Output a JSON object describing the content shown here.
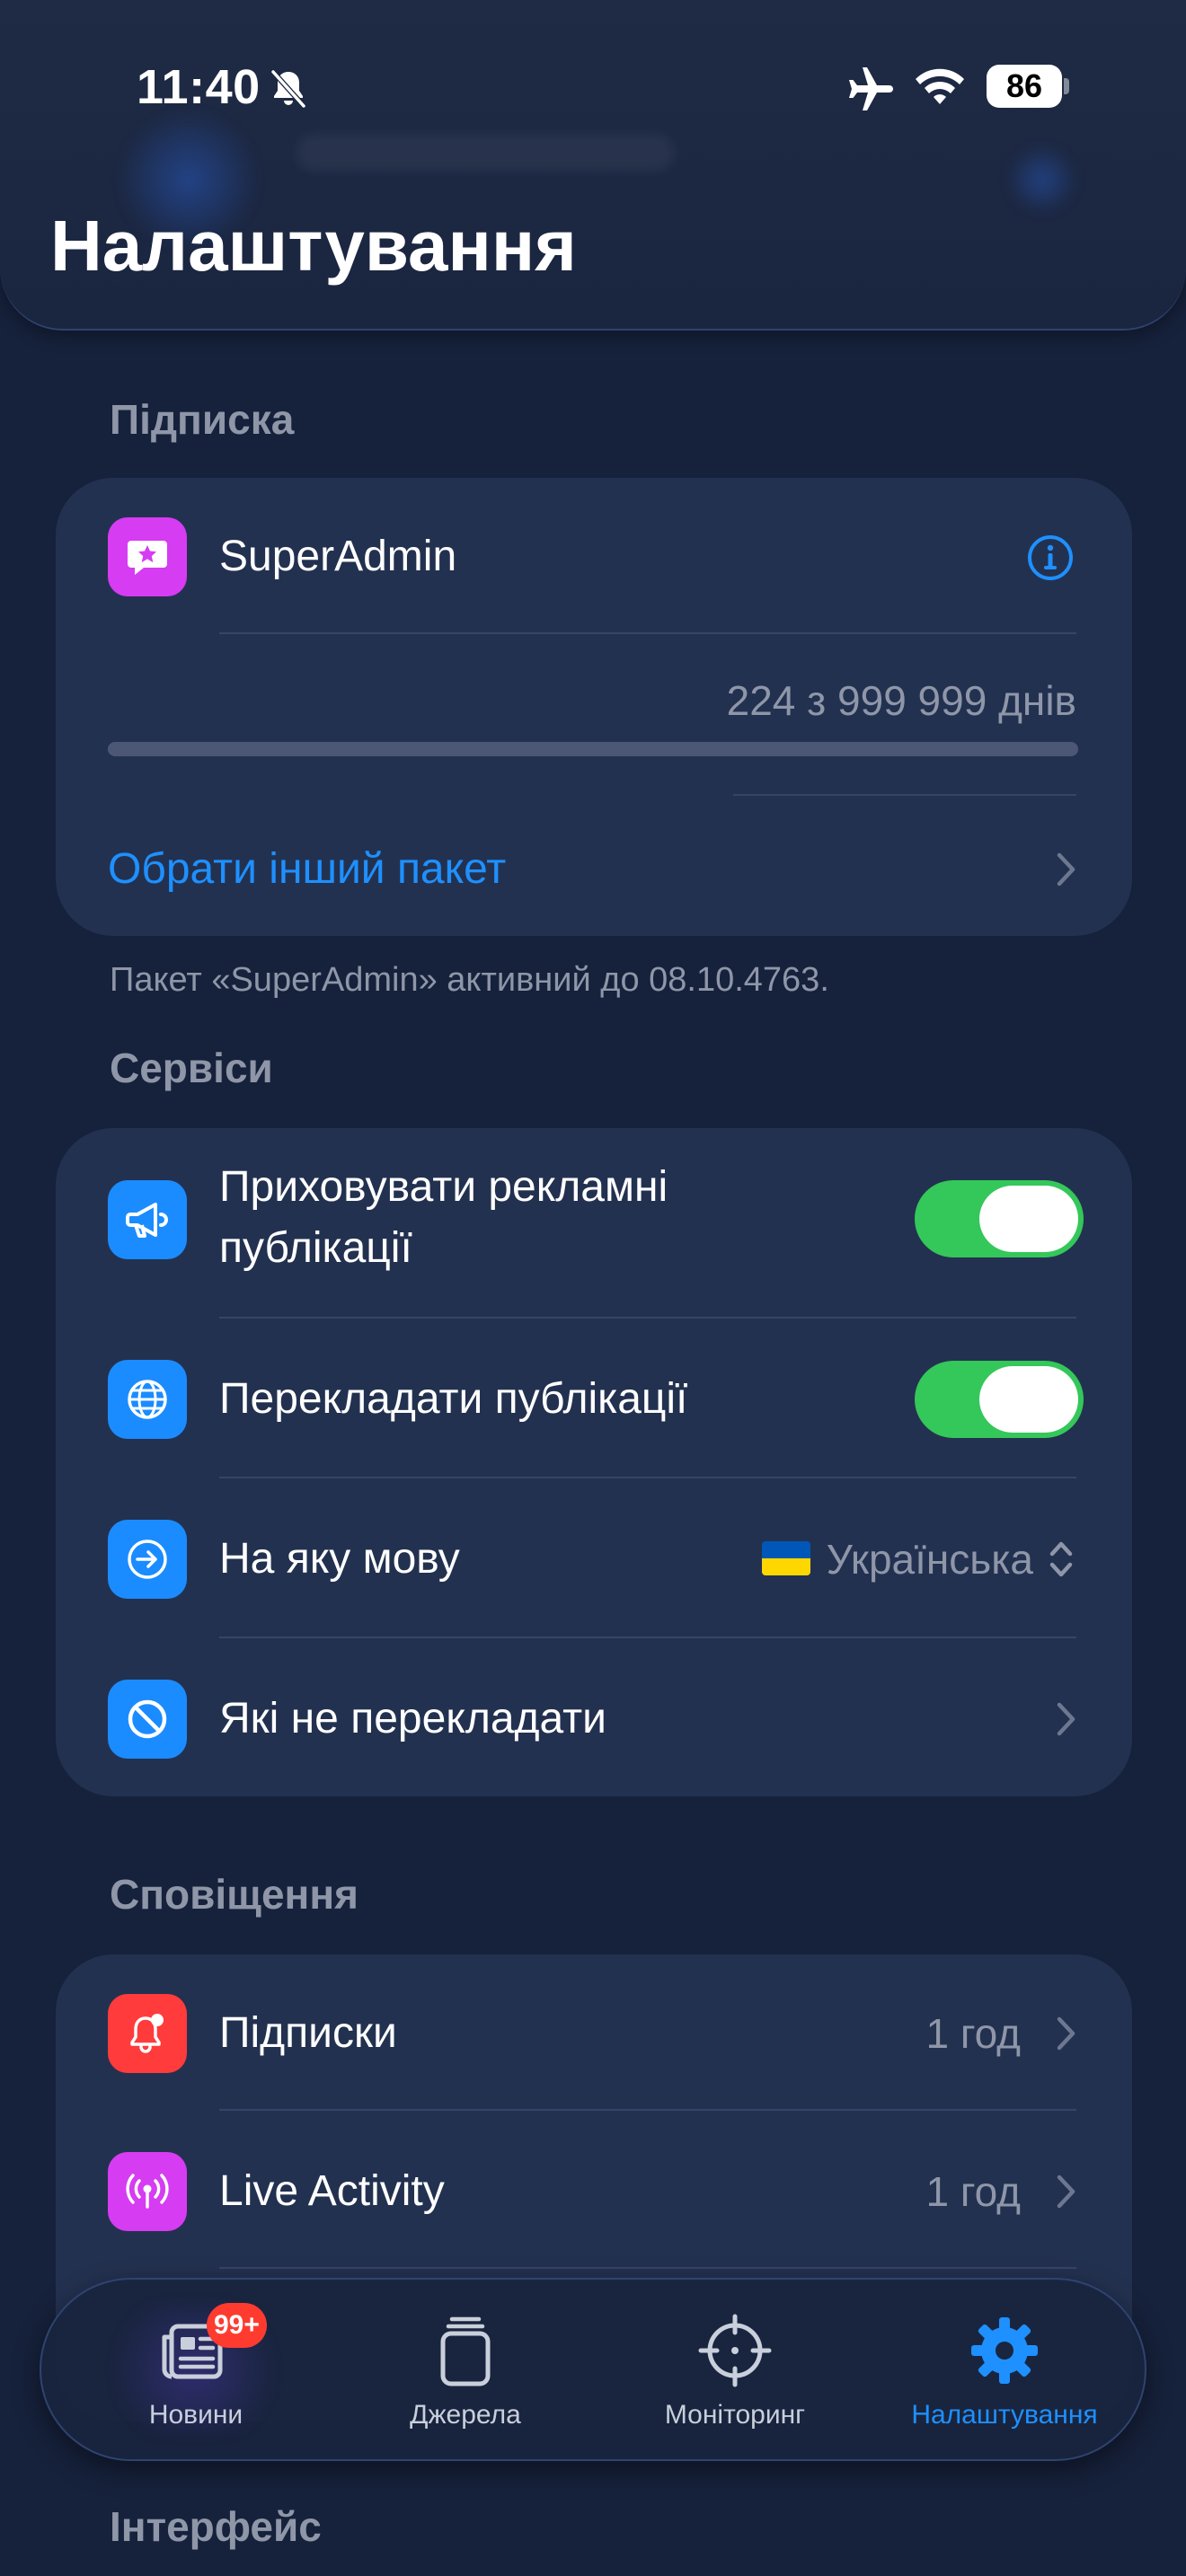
{
  "status_bar": {
    "time": "11:40",
    "battery": "86"
  },
  "header": {
    "title": "Налаштування"
  },
  "subscription": {
    "section_title": "Підписка",
    "plan_name": "SuperAdmin",
    "days_text": "224 з 999 999 днів",
    "days_used": 224,
    "days_total": 999999,
    "change_plan": "Обрати інший пакет",
    "footnote": "Пакет «SuperAdmin» активний до 08.10.4763."
  },
  "services": {
    "section_title": "Сервіси",
    "hide_ads_label": "Приховувати рекламні публікації",
    "hide_ads_line1": "Приховувати рекламні",
    "hide_ads_line2": "публікації",
    "hide_ads_on": true,
    "translate_label": "Перекладати публікації",
    "translate_on": true,
    "language_label": "На яку мову",
    "language_flag": "🇺🇦",
    "language_value": "Українська",
    "exclude_label": "Які не перекладати"
  },
  "notifications": {
    "section_title": "Сповіщення",
    "items": [
      {
        "label": "Підписки",
        "value": "1 год"
      },
      {
        "label": "Live Activity",
        "value": "1 год"
      }
    ]
  },
  "interface": {
    "section_title": "Інтерфейс"
  },
  "tabbar": {
    "tabs": [
      {
        "label": "Новини",
        "badge": "99+"
      },
      {
        "label": "Джерела"
      },
      {
        "label": "Моніторинг"
      },
      {
        "label": "Налаштування"
      }
    ],
    "active_index": 3
  },
  "colors": {
    "background": "#16213b",
    "card": "#233150",
    "accent": "#1e90ff",
    "toggle_on": "#34c759",
    "icon_purple": "#d63cf2",
    "icon_blue": "#1a8cff",
    "icon_red": "#ff3b3b",
    "badge_red": "#ff3b30"
  }
}
